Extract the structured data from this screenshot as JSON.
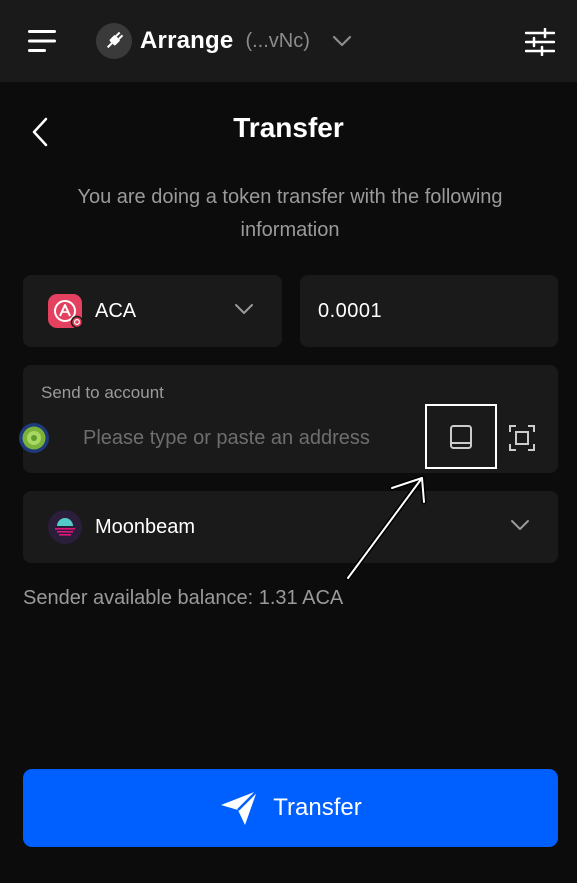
{
  "header": {
    "account_name": "Arrange",
    "account_address": "(...vNc)",
    "menu_icon": "hamburger-menu-icon",
    "account_icon": "plug-icon",
    "chevron_icon": "chevron-down-icon",
    "settings_icon": "sliders-icon"
  },
  "page": {
    "title": "Transfer",
    "description": "You are doing a token transfer with the following information",
    "back_icon": "chevron-left-icon"
  },
  "form": {
    "token": {
      "name": "ACA",
      "icon": "acala-token-icon",
      "accent_color": "#e4405f"
    },
    "amount": {
      "value": "0.0001"
    },
    "recipient": {
      "label": "Send to account",
      "placeholder": "Please type or paste an address",
      "value": "",
      "address_book_icon": "book-icon",
      "scan_icon": "scan-qr-icon"
    },
    "chain": {
      "name": "Moonbeam",
      "icon": "moonbeam-logo-icon"
    },
    "balance_text": "Sender available balance: 1.31 ACA"
  },
  "footer": {
    "transfer_button_label": "Transfer",
    "transfer_icon": "paper-plane-icon",
    "accent_color": "#0060ff"
  }
}
